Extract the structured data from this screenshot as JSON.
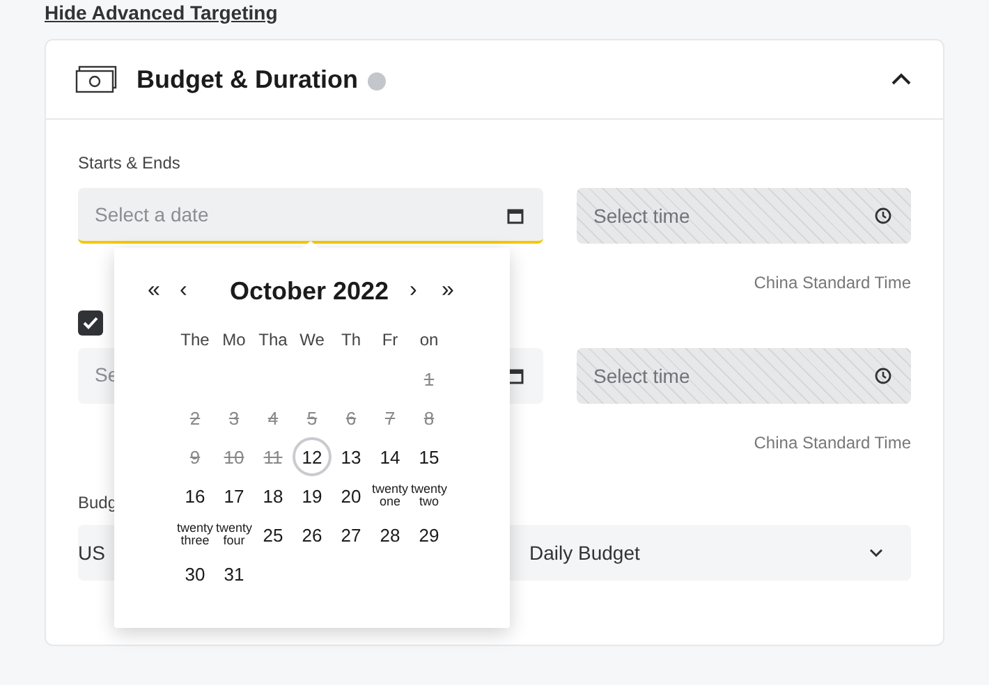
{
  "link": {
    "text": "Hide Advanced Targeting"
  },
  "section": {
    "title": "Budget & Duration",
    "expanded": true
  },
  "schedule": {
    "label": "Starts & Ends",
    "start": {
      "date_placeholder": "Select a date",
      "focused": true,
      "time_placeholder": "Select time",
      "time_disabled": true,
      "timezone": "China Standard Time"
    },
    "end_checked": true,
    "end": {
      "date_placeholder": "Se",
      "focused": false,
      "time_placeholder": "Select time",
      "time_disabled": true,
      "timezone": "China Standard Time"
    }
  },
  "budget": {
    "label": "Budg",
    "currency": "US",
    "type": "Daily Budget"
  },
  "calendar": {
    "prev": [
      "«",
      "‹"
    ],
    "title": "October 2022",
    "next": [
      "›",
      "»"
    ],
    "weekdays": [
      "The",
      "Mo",
      "Tha",
      "We",
      "Th",
      "Fr",
      "on"
    ],
    "weeks": [
      [
        {
          "text": "1",
          "disabled": true,
          "today": false
        }
      ],
      [
        {
          "text": "2",
          "disabled": true,
          "today": false
        },
        {
          "text": "3",
          "disabled": true,
          "today": false
        },
        {
          "text": "4",
          "disabled": true,
          "today": false
        },
        {
          "text": "5",
          "disabled": true,
          "today": false
        },
        {
          "text": "6",
          "disabled": true,
          "today": false
        },
        {
          "text": "7",
          "disabled": true,
          "today": false
        },
        {
          "text": "8",
          "disabled": true,
          "today": false
        }
      ],
      [
        {
          "text": "9",
          "disabled": true,
          "today": false
        },
        {
          "text": "10",
          "disabled": true,
          "today": false
        },
        {
          "text": "11",
          "disabled": true,
          "today": false
        },
        {
          "text": "12",
          "disabled": false,
          "today": true
        },
        {
          "text": "13",
          "disabled": false,
          "today": false
        },
        {
          "text": "14",
          "disabled": false,
          "today": false
        },
        {
          "text": "15",
          "disabled": false,
          "today": false
        }
      ],
      [
        {
          "text": "16",
          "disabled": false,
          "today": false
        },
        {
          "text": "17",
          "disabled": false,
          "today": false
        },
        {
          "text": "18",
          "disabled": false,
          "today": false
        },
        {
          "text": "19",
          "disabled": false,
          "today": false
        },
        {
          "text": "20",
          "disabled": false,
          "today": false
        },
        {
          "text": "twenty one",
          "disabled": false,
          "today": false
        },
        {
          "text": "twenty two",
          "disabled": false,
          "today": false
        }
      ],
      [
        {
          "text": "twenty three",
          "disabled": false,
          "today": false
        },
        {
          "text": "twenty four",
          "disabled": false,
          "today": false
        },
        {
          "text": "25",
          "disabled": false,
          "today": false
        },
        {
          "text": "26",
          "disabled": false,
          "today": false
        },
        {
          "text": "27",
          "disabled": false,
          "today": false
        },
        {
          "text": "28",
          "disabled": false,
          "today": false
        },
        {
          "text": "29",
          "disabled": false,
          "today": false
        }
      ],
      [
        {
          "text": "30",
          "disabled": false,
          "today": false
        },
        {
          "text": "31",
          "disabled": false,
          "today": false
        }
      ]
    ]
  }
}
